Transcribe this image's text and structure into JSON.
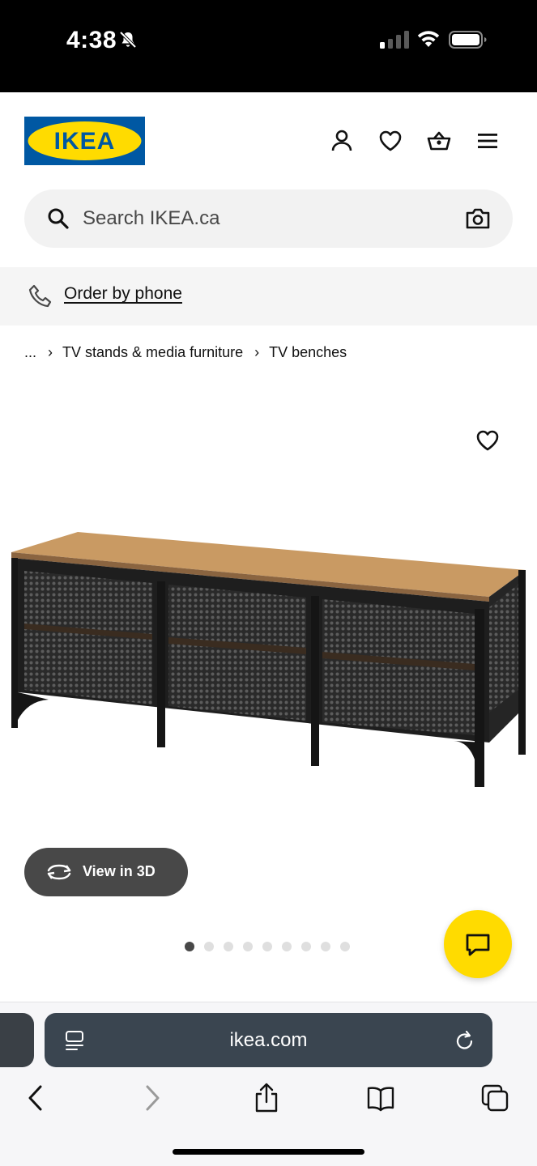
{
  "status_bar": {
    "time": "4:38"
  },
  "header": {
    "logo_text": "IKEA",
    "brand_colors": {
      "blue": "#0058a3",
      "yellow": "#ffdb00"
    },
    "icons": [
      "account-icon",
      "favourites-icon",
      "cart-icon",
      "menu-icon"
    ]
  },
  "search": {
    "placeholder": "Search IKEA.ca"
  },
  "phone": {
    "label": "Order by phone"
  },
  "breadcrumb": {
    "ellipsis": "...",
    "items": [
      "TV stands & media furniture",
      "TV benches"
    ]
  },
  "product": {
    "view_3d_label": "View in 3D",
    "image_count": 9,
    "active_image_index": 0
  },
  "browser": {
    "url": "ikea.com"
  }
}
